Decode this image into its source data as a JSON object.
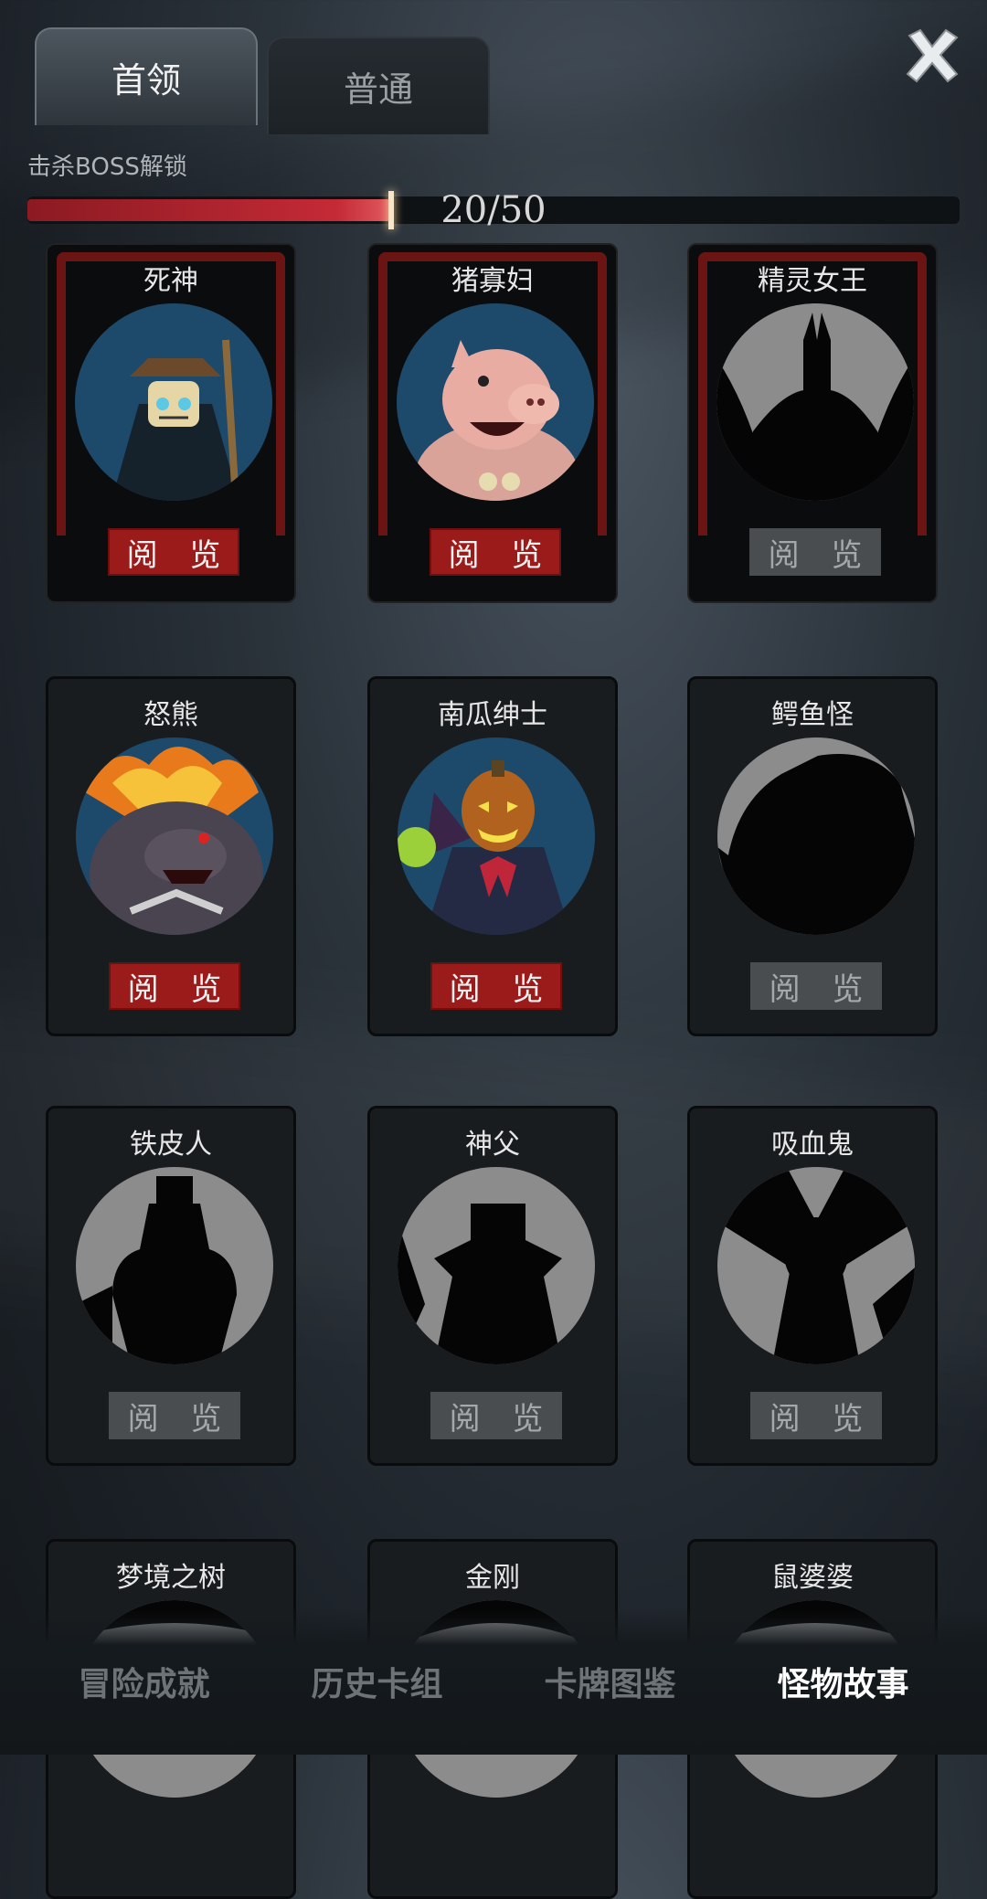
{
  "tabs": {
    "boss": "首领",
    "normal": "普通"
  },
  "unlock_label": "击杀BOSS解锁",
  "progress": {
    "text": "20/50",
    "current": 20,
    "total": 50,
    "fill_fraction": 0.39
  },
  "view_label": "阅 览",
  "cards": [
    {
      "name": "死神",
      "unlocked": true
    },
    {
      "name": "猪寡妇",
      "unlocked": true
    },
    {
      "name": "精灵女王",
      "unlocked": false
    },
    {
      "name": "怒熊",
      "unlocked": true
    },
    {
      "name": "南瓜绅士",
      "unlocked": true
    },
    {
      "name": "鳄鱼怪",
      "unlocked": false
    },
    {
      "name": "铁皮人",
      "unlocked": false
    },
    {
      "name": "神父",
      "unlocked": false
    },
    {
      "name": "吸血鬼",
      "unlocked": false
    },
    {
      "name": "梦境之树",
      "unlocked": false
    },
    {
      "name": "金刚",
      "unlocked": false
    },
    {
      "name": "鼠婆婆",
      "unlocked": false
    }
  ],
  "bottom_nav": [
    "冒险成就",
    "历史卡组",
    "卡牌图鉴",
    "怪物故事"
  ],
  "colors": {
    "accent_red": "#9b1a1a",
    "progress_red": "#c42a36"
  }
}
